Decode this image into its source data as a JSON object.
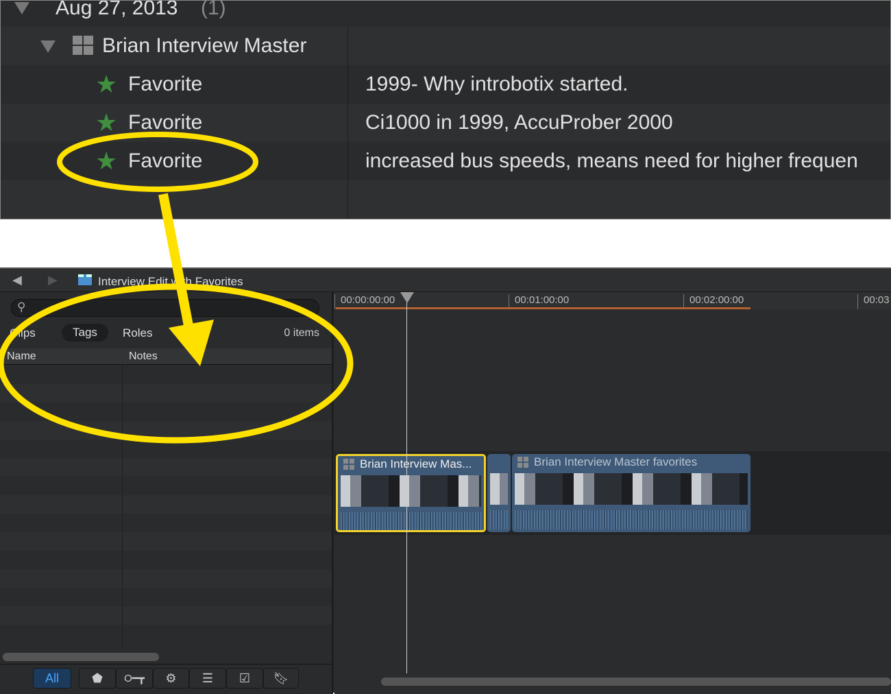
{
  "library": {
    "date_group": "Aug 27, 2013",
    "date_count": "(1)",
    "clip_name": "Brian Interview Master",
    "rows": [
      {
        "tag": "Favorite",
        "note": "1999- Why introbotix started."
      },
      {
        "tag": "Favorite",
        "note": "Ci1000 in 1999, AccuProber 2000"
      },
      {
        "tag": "Favorite",
        "note": "increased bus speeds, means need for higher frequen"
      }
    ]
  },
  "toolbar": {
    "project_title": "Interview Edit with Favorites"
  },
  "index": {
    "search_placeholder": "",
    "tabs": [
      "Clips",
      "Tags",
      "Roles"
    ],
    "active_tab": "Tags",
    "count": "0 items",
    "columns": [
      "Name",
      "Notes"
    ],
    "filters": {
      "all": "All",
      "icons": [
        "marker-icon",
        "keyword-icon",
        "gear-icon",
        "list-icon",
        "todo-icon",
        "chapter-icon"
      ]
    }
  },
  "timeline": {
    "ruler": [
      "00:00:00:00",
      "00:01:00:00",
      "00:02:00:00",
      "00:03"
    ],
    "clips": [
      {
        "title": "Brian Interview Mas...",
        "selected": true
      },
      {
        "title": "",
        "selected": false
      },
      {
        "title": "Brian Interview Master favorites",
        "selected": false
      }
    ]
  },
  "colors": {
    "annotation": "#ffe100",
    "favorite": "#3f8f3f",
    "clip": "#3f5a78",
    "accent": "#4aa3ff"
  }
}
